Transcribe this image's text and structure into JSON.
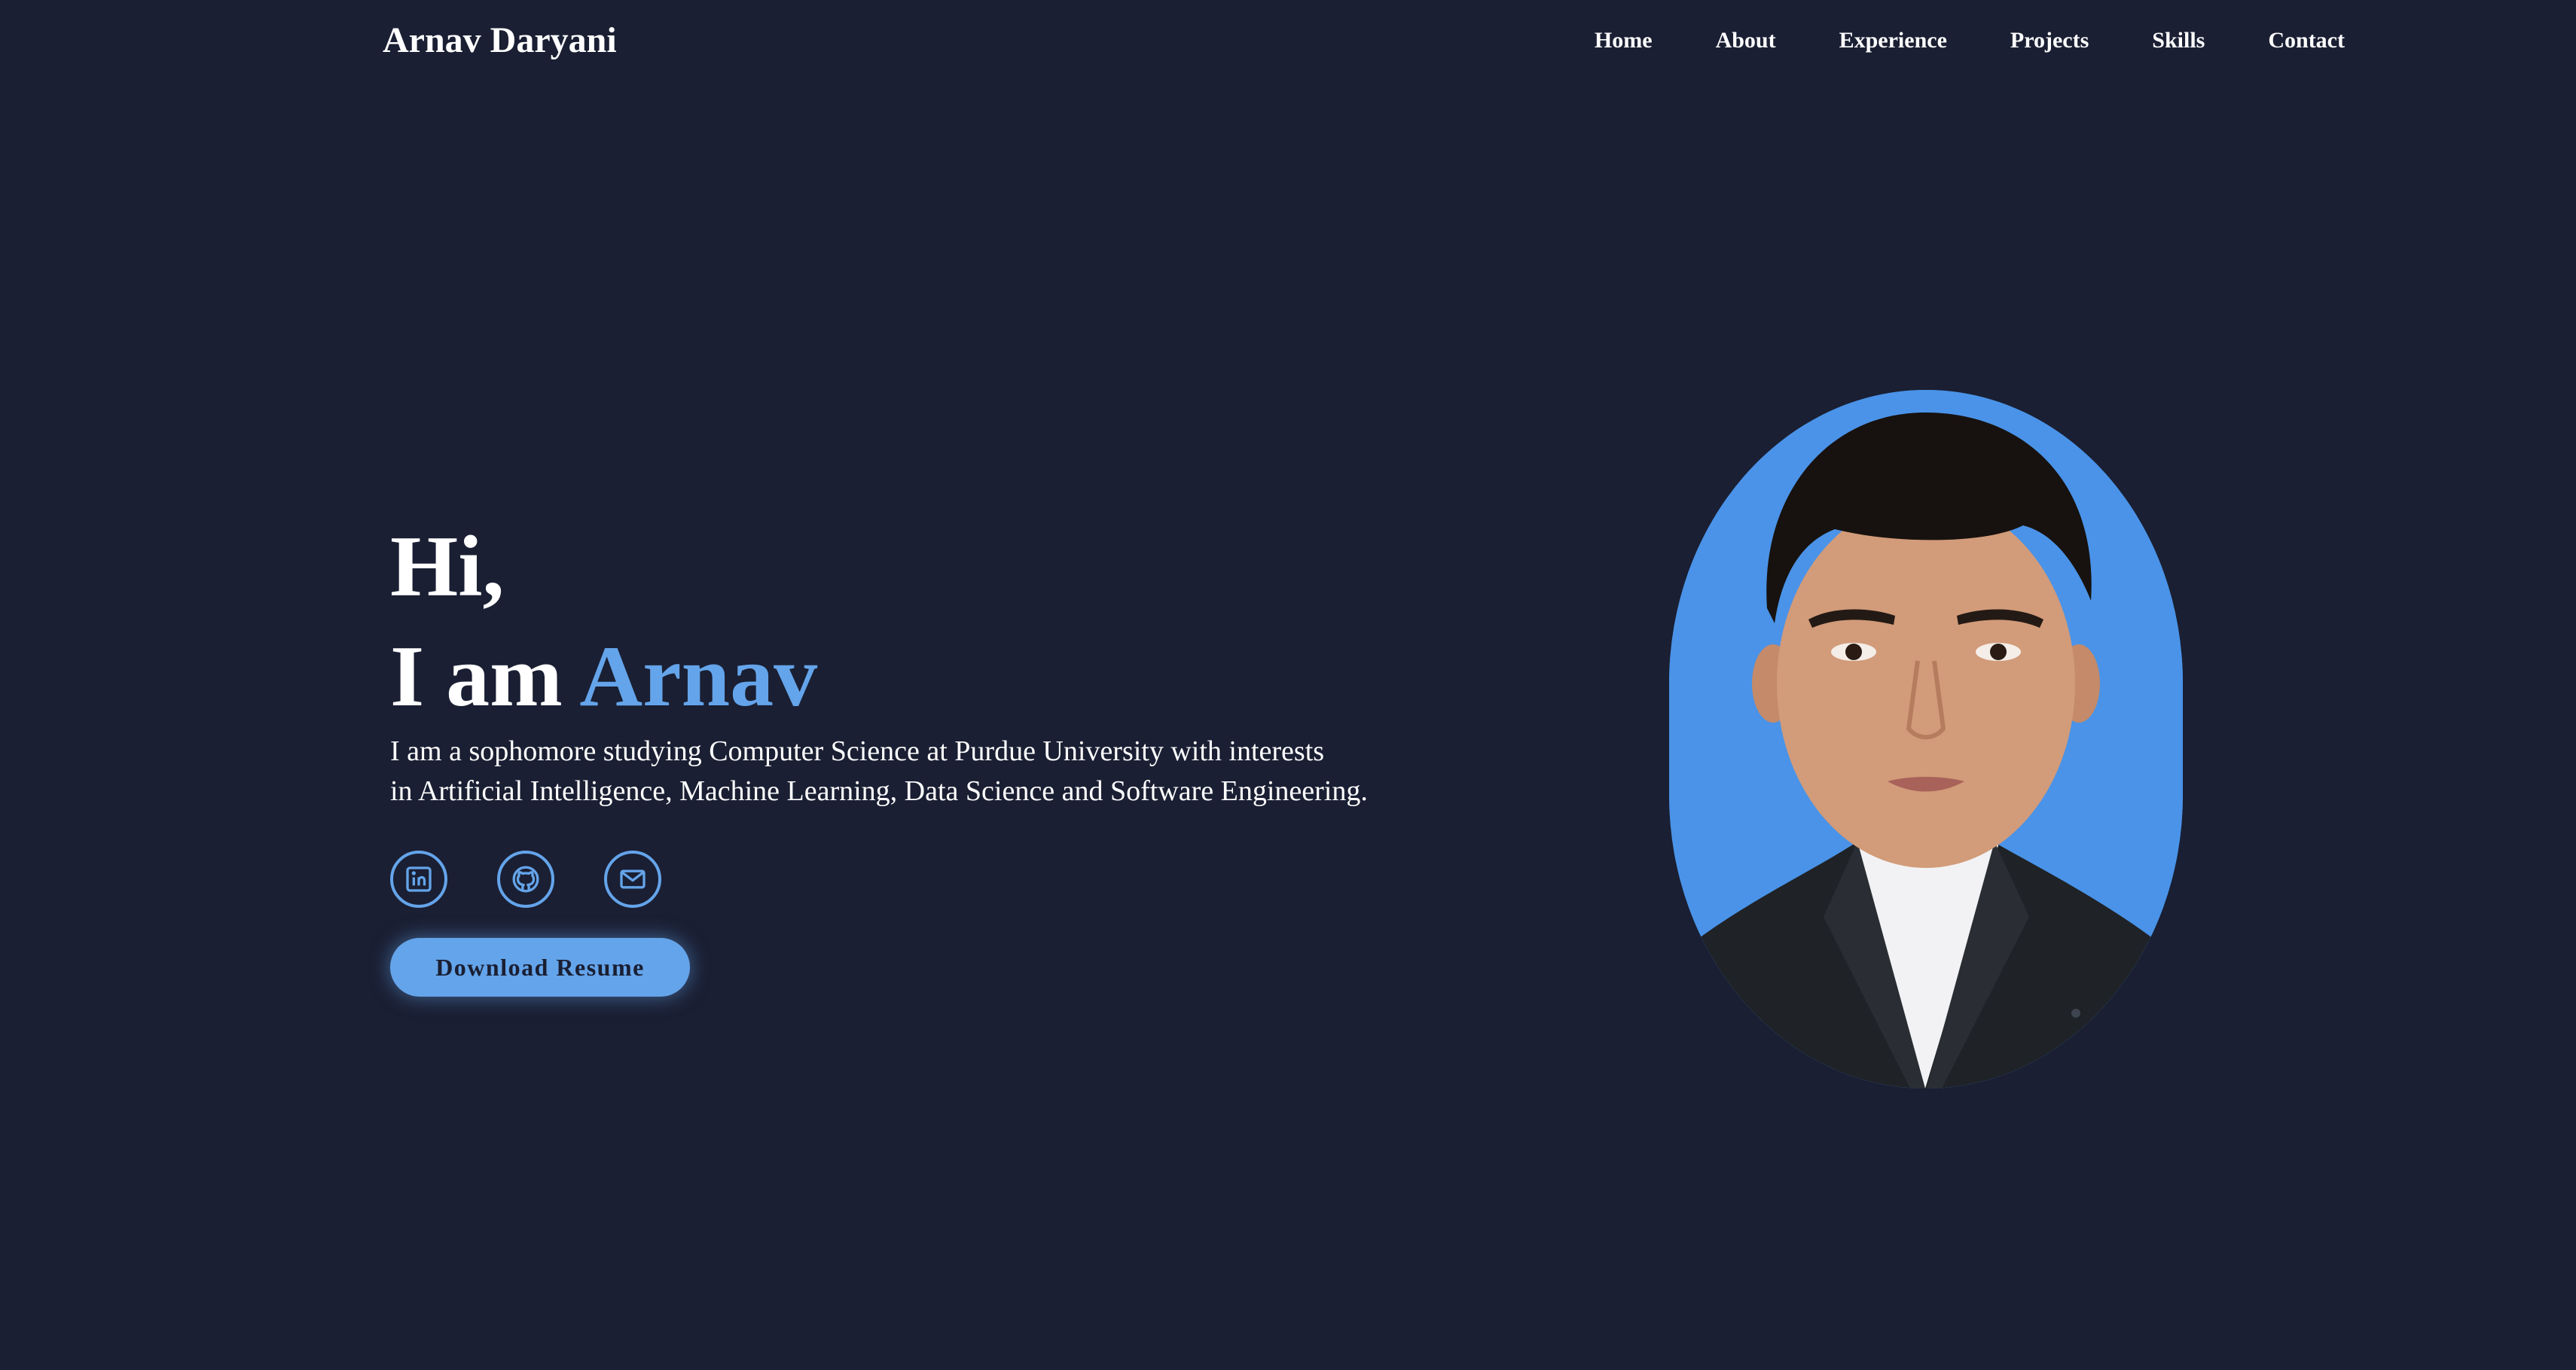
{
  "header": {
    "brand": "Arnav Daryani",
    "nav": [
      "Home",
      "About",
      "Experience",
      "Projects",
      "Skills",
      "Contact"
    ]
  },
  "hero": {
    "greeting_line1": "Hi,",
    "greeting_prefix": "I am ",
    "greeting_name": "Arnav",
    "description_line1": "I am a sophomore studying Computer Science at Purdue University with interests",
    "description_line2": "in Artificial Intelligence, Machine Learning, Data Science and Software Engineering.",
    "socials": [
      {
        "icon": "linkedin-icon"
      },
      {
        "icon": "github-icon"
      },
      {
        "icon": "mail-icon"
      }
    ],
    "resume_button": "Download Resume"
  },
  "colors": {
    "background": "#1a1f33",
    "accent": "#64a4ea",
    "portrait_background": "#4a93e8",
    "text": "#ffffff"
  }
}
